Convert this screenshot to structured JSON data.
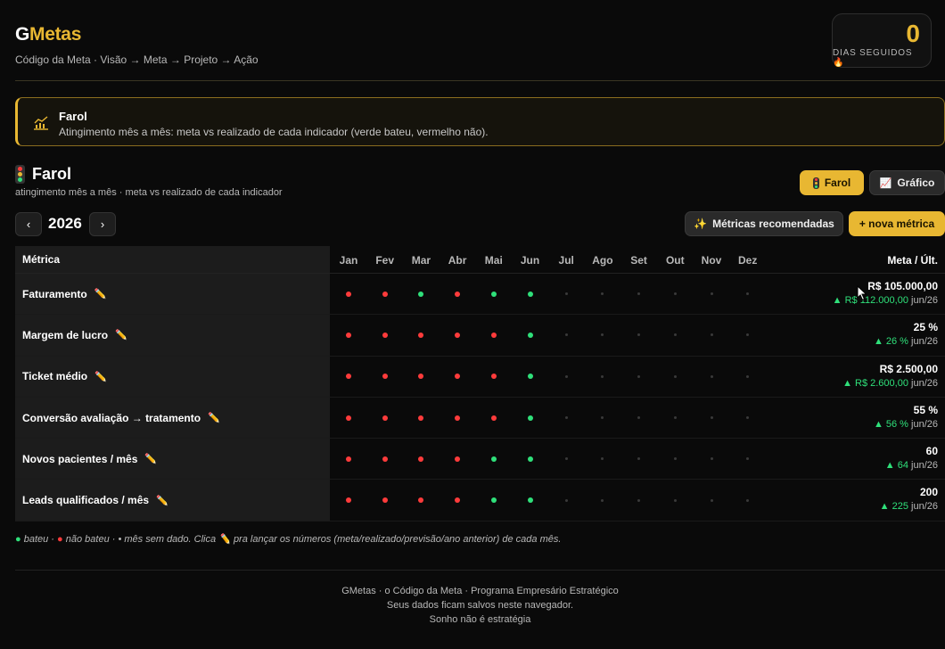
{
  "header": {
    "logo_g": "G",
    "logo_rest": "Metas",
    "tagline": "Código da Meta · Visão → Meta → Projeto → Ação",
    "streak_count": "0",
    "streak_label": "DIAS SEGUIDOS",
    "streak_icon": "fire-icon"
  },
  "banner": {
    "icon": "chart-line-icon",
    "title": "Farol",
    "text": "Atingimento mês a mês: meta vs realizado de cada indicador (verde bateu, vermelho não)."
  },
  "section": {
    "icon": "traffic-light-icon",
    "title": "Farol",
    "subtitle": "atingimento mês a mês · meta vs realizado de cada indicador"
  },
  "view_toggle": {
    "farol_label": "Farol",
    "grafico_label": "Gráfico",
    "active": "Farol"
  },
  "year_nav": {
    "prev": "‹",
    "year": "2026",
    "next": "›"
  },
  "actions": {
    "recommended_label": "Métricas recomendadas",
    "new_label": "+ nova métrica"
  },
  "colors": {
    "accent": "#e8b732",
    "hit": "#2fe07a",
    "miss": "#ff3b3b",
    "no_data": "#3a3a3a"
  },
  "table": {
    "metric_header": "Métrica",
    "meta_header": "Meta / Últ.",
    "months": [
      "Jan",
      "Fev",
      "Mar",
      "Abr",
      "Mai",
      "Jun",
      "Jul",
      "Ago",
      "Set",
      "Out",
      "Nov",
      "Dez"
    ],
    "rows": [
      {
        "name": "Faturamento",
        "status": [
          "r",
          "r",
          "g",
          "r",
          "g",
          "g",
          "n",
          "n",
          "n",
          "n",
          "n",
          "n"
        ],
        "meta": "R$ 105.000,00",
        "last": "▲ R$ 112.000,00",
        "when": "jun/26"
      },
      {
        "name": "Margem de lucro",
        "status": [
          "r",
          "r",
          "r",
          "r",
          "r",
          "g",
          "n",
          "n",
          "n",
          "n",
          "n",
          "n"
        ],
        "meta": "25 %",
        "last": "▲ 26 %",
        "when": "jun/26"
      },
      {
        "name": "Ticket médio",
        "status": [
          "r",
          "r",
          "r",
          "r",
          "r",
          "g",
          "n",
          "n",
          "n",
          "n",
          "n",
          "n"
        ],
        "meta": "R$ 2.500,00",
        "last": "▲ R$ 2.600,00",
        "when": "jun/26"
      },
      {
        "name": "Conversão avaliação → tratamento",
        "status": [
          "r",
          "r",
          "r",
          "r",
          "r",
          "g",
          "n",
          "n",
          "n",
          "n",
          "n",
          "n"
        ],
        "meta": "55 %",
        "last": "▲ 56 %",
        "when": "jun/26"
      },
      {
        "name": "Novos pacientes / mês",
        "status": [
          "r",
          "r",
          "r",
          "r",
          "g",
          "g",
          "n",
          "n",
          "n",
          "n",
          "n",
          "n"
        ],
        "meta": "60",
        "last": "▲ 64",
        "when": "jun/26"
      },
      {
        "name": "Leads qualificados / mês",
        "status": [
          "r",
          "r",
          "r",
          "r",
          "g",
          "g",
          "n",
          "n",
          "n",
          "n",
          "n",
          "n"
        ],
        "meta": "200",
        "last": "▲ 225",
        "when": "jun/26"
      }
    ]
  },
  "legend": {
    "hit": "bateu",
    "miss": "não bateu",
    "empty": "mês sem dado. Clica",
    "rest": "pra lançar os números (meta/realizado/previsão/ano anterior) de cada mês."
  },
  "footer": {
    "line1": "GMetas · o Código da Meta · Programa Empresário Estratégico",
    "line2": "Seus dados ficam salvos neste navegador.",
    "line3": "Sonho não é estratégia"
  }
}
